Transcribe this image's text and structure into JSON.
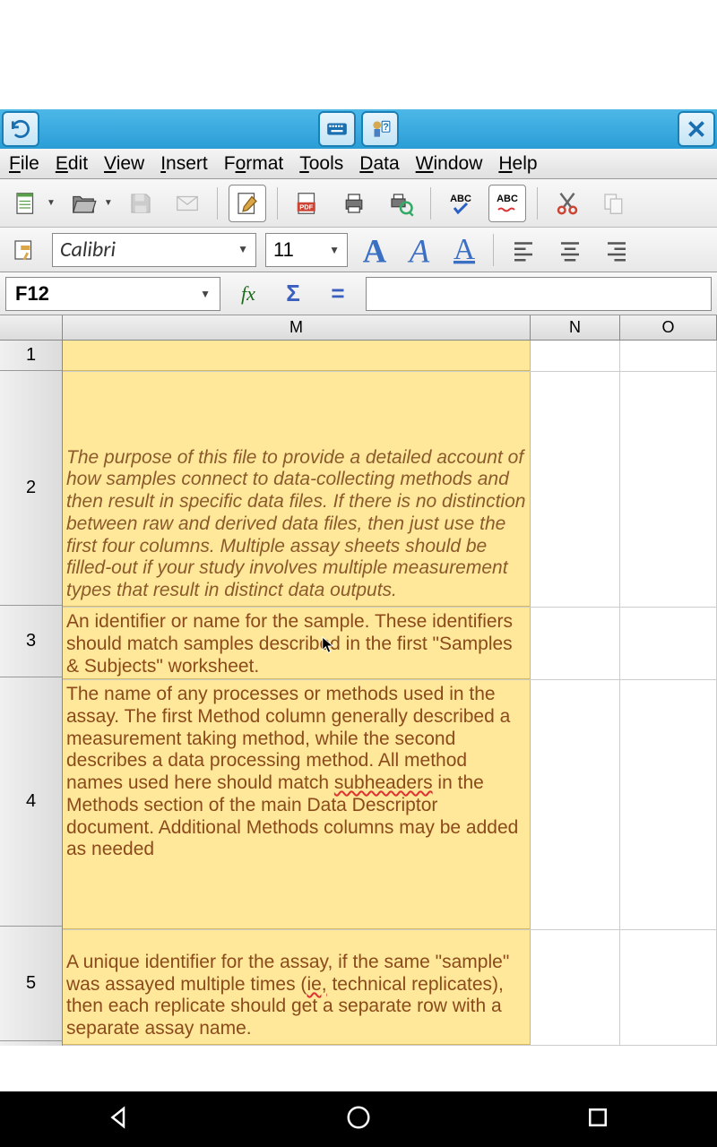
{
  "menubar": {
    "file": "File",
    "edit": "Edit",
    "view": "View",
    "insert": "Insert",
    "format": "Format",
    "tools": "Tools",
    "data": "Data",
    "window": "Window",
    "help": "Help"
  },
  "toolbar2": {
    "font": "Calibri",
    "size": "11"
  },
  "formulabar": {
    "cellref": "F12",
    "fx": "fx",
    "sigma": "Σ",
    "eq": "=",
    "input": ""
  },
  "columns": {
    "M": "M",
    "N": "N",
    "O": "O"
  },
  "rows": {
    "r1": "1",
    "r2": "2",
    "r3": "3",
    "r4": "4",
    "r5": "5"
  },
  "cells": {
    "M1": "",
    "M2": "The purpose of this file to provide a detailed account of how samples connect to data-collecting methods and then result in specific data files.  If there is no distinction between raw and derived data files, then just use the first four columns. Multiple assay sheets should be filled-out if your study involves multiple measurement types that result in distinct data outputs.",
    "M3": "An identifier or name for the  sample.  These identifiers should match samples described in the first \"Samples & Subjects\" worksheet.",
    "M4_a": "The name of any processes or methods used in the assay.  The first Method column generally described a measurement taking method, while the second describes a data processing method.  All method names used here should match ",
    "M4_sub": "subheaders",
    "M4_b": " in the Methods section of the main Data Descriptor document. Additional Methods columns may be added as needed",
    "M5_a": "A unique identifier for the assay, if the same \"sample\" was assayed multiple times (",
    "M5_ie": "ie,",
    "M5_b": " technical replicates), then each replicate should get a separate row with a separate assay name."
  },
  "icons": {
    "abc_check": "ABC",
    "abc_auto": "ABC"
  }
}
